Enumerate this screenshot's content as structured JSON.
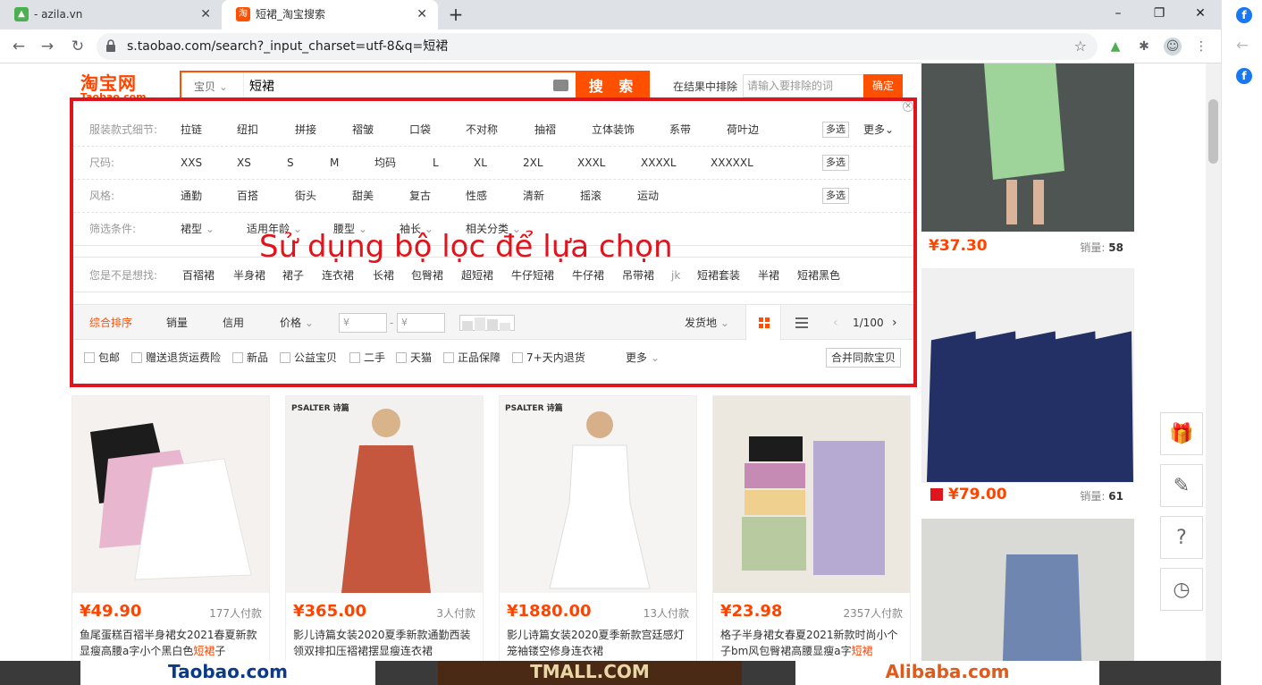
{
  "browser": {
    "tabs": [
      {
        "title": "- azila.vn",
        "active": false
      },
      {
        "title": "短裙_淘宝搜索",
        "active": true
      }
    ],
    "new_tab": "+",
    "url": "s.taobao.com/search?_input_charset=utf-8&q=短裙",
    "window_controls": {
      "minimize": "–",
      "restore": "❐",
      "close": "✕"
    }
  },
  "header": {
    "logo_cn": "淘宝网",
    "logo_en": "Taobao.com",
    "search_category": "宝贝",
    "search_query": "短裙",
    "search_button": "搜 索",
    "exclude_label": "在结果中排除",
    "exclude_placeholder": "请输入要排除的词",
    "exclude_button": "确定"
  },
  "filters": {
    "rows": [
      {
        "label": "服装款式细节:",
        "values": [
          "拉链",
          "纽扣",
          "拼接",
          "褶皱",
          "口袋",
          "不对称",
          "抽褶",
          "立体装饰",
          "系带",
          "荷叶边"
        ],
        "multi": "多选",
        "more": "更多"
      },
      {
        "label": "尺码:",
        "values": [
          "XXS",
          "XS",
          "S",
          "M",
          "均码",
          "L",
          "XL",
          "2XL",
          "XXXL",
          "XXXXL",
          "XXXXXL"
        ],
        "multi": "多选"
      },
      {
        "label": "风格:",
        "values": [
          "通勤",
          "百搭",
          "街头",
          "甜美",
          "复古",
          "性感",
          "清新",
          "摇滚",
          "运动"
        ],
        "multi": "多选"
      },
      {
        "label": "筛选条件:",
        "values": [
          "裙型",
          "适用年龄",
          "腰型",
          "袖长",
          "相关分类"
        ]
      }
    ],
    "suggest_label": "您是不是想找:",
    "suggestions": [
      "百褶裙",
      "半身裙",
      "裙子",
      "连衣裙",
      "长裙",
      "包臀裙",
      "超短裙",
      "牛仔短裙",
      "牛仔裙",
      "吊带裙",
      "jk",
      "短裙套装",
      "半裙",
      "短裙黑色"
    ],
    "sort": {
      "items": [
        "综合排序",
        "销量",
        "信用",
        "价格"
      ],
      "active": "综合排序",
      "price_from": "¥",
      "price_to": "¥",
      "ship_from": "发货地",
      "page_indicator": "1/100"
    },
    "checks": [
      "包邮",
      "赠送退货运费险",
      "新品",
      "公益宝贝",
      "二手",
      "天猫",
      "正品保障",
      "7+天内退货"
    ],
    "checks_more": "更多",
    "merge_button": "合并同款宝贝"
  },
  "overlay_text": "Sử dụng bộ lọc để lựa chọn",
  "products": [
    {
      "price": "¥49.90",
      "deals": "177人付款",
      "title_a": "鱼尾蛋糕百褶半身裙女2021春夏新款显瘦高腰a字小个黑白色",
      "title_hl": "短裙",
      "title_b": "子",
      "brand": ""
    },
    {
      "price": "¥365.00",
      "deals": "3人付款",
      "title_a": "影儿诗篇女装2020夏季新款通勤西装领双排扣压褶裙摆显瘦连衣裙",
      "title_hl": "",
      "title_b": "",
      "brand": "PSALTER 诗篇"
    },
    {
      "price": "¥1880.00",
      "deals": "13人付款",
      "title_a": "影儿诗篇女装2020夏季新款宫廷感灯笼袖镂空修身连衣裙",
      "title_hl": "",
      "title_b": "",
      "brand": "PSALTER 诗篇"
    },
    {
      "price": "¥23.98",
      "deals": "2357人付款",
      "title_a": "格子半身裙女春夏2021新款时尚小个子bm风包臀裙高腰显瘦a字",
      "title_hl": "短裙",
      "title_b": "",
      "brand": ""
    }
  ],
  "right_ads": [
    {
      "price": "¥37.30",
      "sold_label": "销量:",
      "sold": "58"
    },
    {
      "price": "¥79.00",
      "sold_label": "销量:",
      "sold": "61"
    }
  ],
  "colors": {
    "accent": "#ff5000",
    "highlight_box": "#e0141c",
    "price": "#ff4400"
  }
}
